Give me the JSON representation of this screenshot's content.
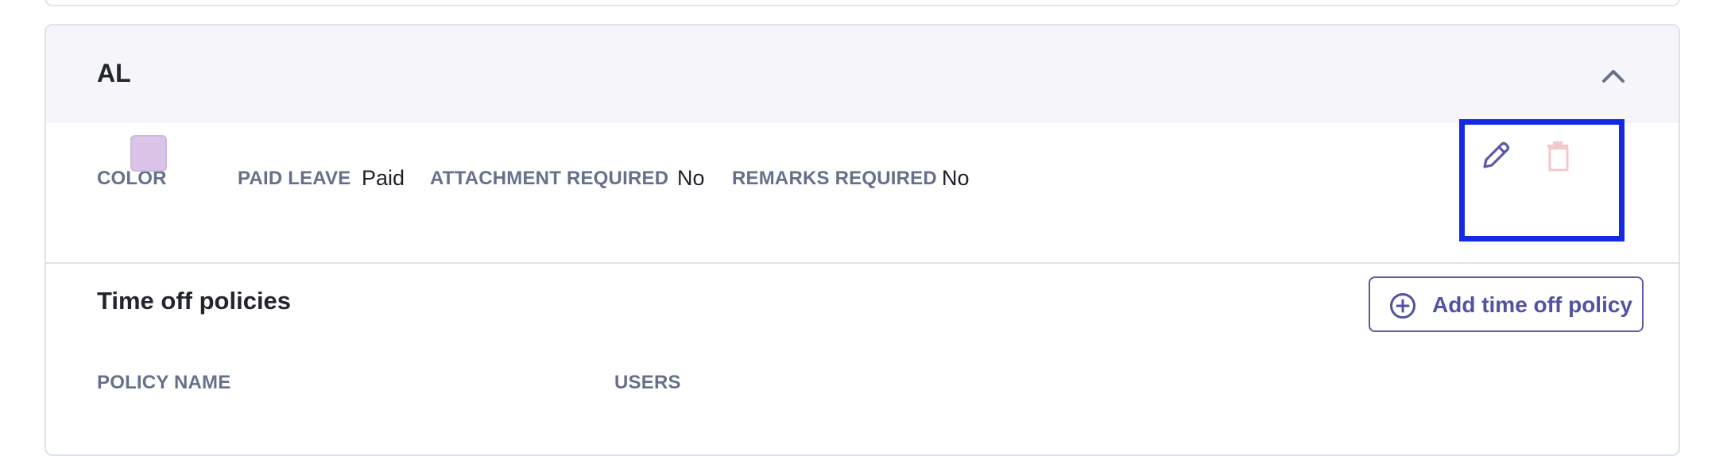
{
  "card": {
    "title": "AL",
    "collapse_icon": "chevron-up-icon"
  },
  "properties": {
    "color_label": "COLOR",
    "color_value": "#dcc4e9",
    "paid_leave_label": "PAID LEAVE",
    "paid_leave_value": "Paid",
    "attachment_label": "ATTACHMENT REQUIRED",
    "attachment_value": "No",
    "remarks_label": "REMARKS REQUIRED",
    "remarks_value": "No"
  },
  "actions": {
    "edit_icon": "pencil-icon",
    "delete_icon": "trash-icon"
  },
  "policies": {
    "title": "Time off policies",
    "add_button_label": "Add time off policy",
    "add_icon": "plus-circle-icon",
    "columns": [
      "POLICY NAME",
      "USERS"
    ]
  },
  "colors": {
    "accent": "#5252a3",
    "highlight": "#1429e6",
    "danger_faint": "#f3c9cc"
  }
}
